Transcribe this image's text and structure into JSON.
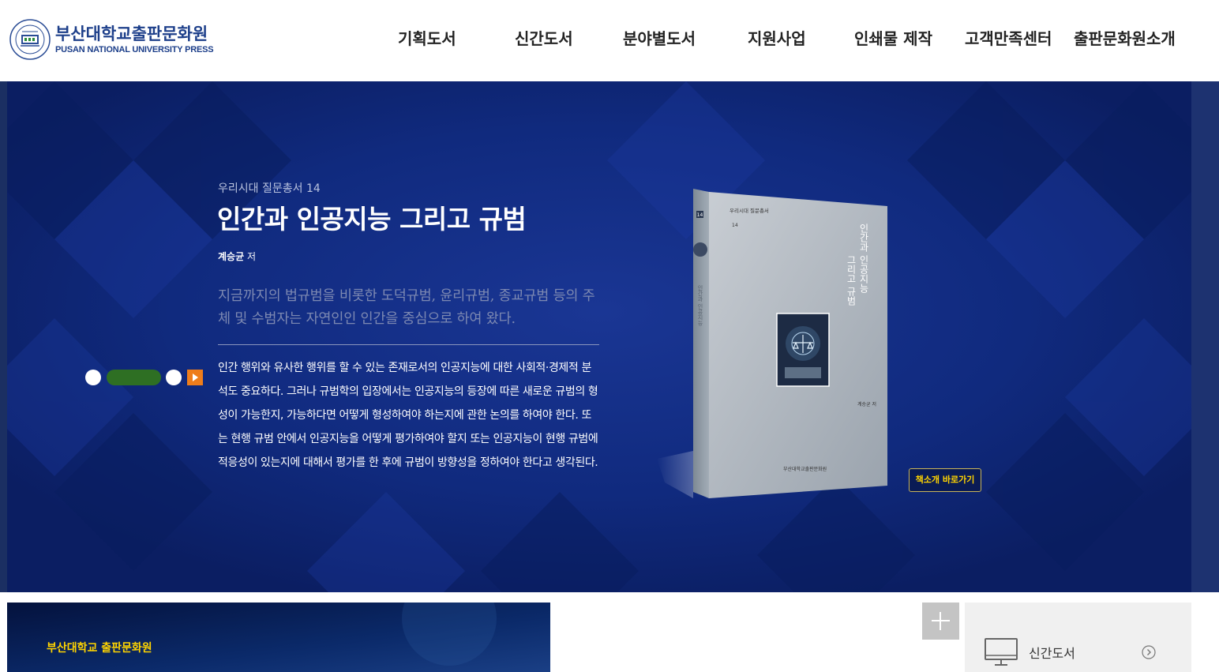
{
  "header": {
    "logo_ko": "부산대학교출판문화원",
    "logo_en": "PUSAN NATIONAL UNIVERSITY PRESS",
    "nav": [
      {
        "label": "기획도서"
      },
      {
        "label": "신간도서"
      },
      {
        "label": "분야별도서"
      },
      {
        "label": "지원사업"
      },
      {
        "label": "인쇄물 제작"
      },
      {
        "label": "고객만족센터"
      },
      {
        "label": "출판문화원소개"
      }
    ]
  },
  "hero": {
    "series": "우리시대 질문총서 14",
    "title": "인간과 인공지능 그리고 규범",
    "author_name": "계승균",
    "author_suffix": "저",
    "lead": "지금까지의 법규범을 비롯한 도덕규범, 윤리규범, 종교규범 등의 주체 및 수범자는 자연인인 인간을 중심으로 하여 왔다.",
    "description": "인간 행위와 유사한 행위를 할 수 있는 존재로서의 인공지능에 대한 사회적·경제적 분석도 중요하다. 그러나 규범학의 입장에서는 인공지능의 등장에 따른 새로운 규범의 형성이 가능한지, 가능하다면 어떻게 형성하여야 하는지에 관한 논의를 하여야 한다. 또는 현행 규범 안에서 인공지능을 어떻게 평가하여야 할지 또는 인공지능이 현행 규범에 적응성이 있는지에 대해서 평가를 한 후에 규범이 방향성을 정하여야 한다고 생각된다.",
    "go_button": "책소개 바로가기",
    "book_cover": {
      "series_small": "우리시대 질문총서",
      "number": "14",
      "title_vertical_1": "인간과 인공지능",
      "title_vertical_2": "그리고 규범",
      "author_small": "계승균 저",
      "publisher": "부산대학교출판문화원"
    },
    "colors": {
      "background": "#0e2470",
      "pager_active": "#2e6f23",
      "play": "#ee7d1b",
      "button_text": "#ffd400"
    }
  },
  "bottom": {
    "banner_label": "부산대학교 출판문화원",
    "new_books_label": "신간도서",
    "plus_icon": "plus-icon",
    "monitor_icon": "monitor-icon"
  }
}
